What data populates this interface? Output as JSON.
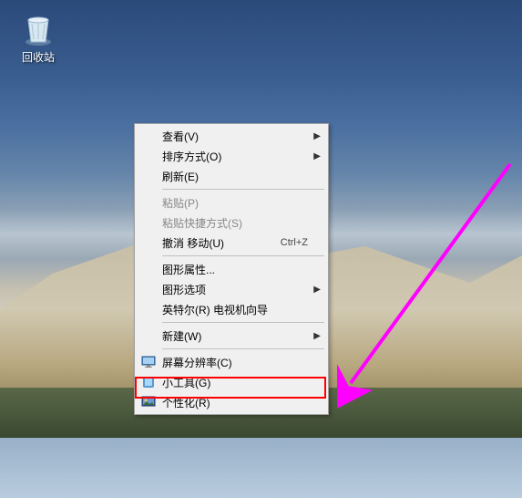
{
  "desktop": {
    "recycle_bin_label": "回收站"
  },
  "context_menu": {
    "items": [
      {
        "label": "查看(V)",
        "submenu": true
      },
      {
        "label": "排序方式(O)",
        "submenu": true
      },
      {
        "label": "刷新(E)"
      },
      null,
      {
        "label": "粘贴(P)",
        "disabled": true
      },
      {
        "label": "粘贴快捷方式(S)",
        "disabled": true
      },
      {
        "label": "撤消 移动(U)",
        "shortcut": "Ctrl+Z"
      },
      null,
      {
        "label": "图形属性..."
      },
      {
        "label": "图形选项",
        "submenu": true
      },
      {
        "label": "英特尔(R) 电视机向导"
      },
      null,
      {
        "label": "新建(W)",
        "submenu": true
      },
      null,
      {
        "label": "屏幕分辨率(C)",
        "icon": "monitor"
      },
      {
        "label": "小工具(G)",
        "icon": "gadget"
      },
      {
        "label": "个性化(R)",
        "icon": "personalize",
        "highlighted": true
      }
    ]
  },
  "annotation": {
    "highlight_color": "#ff0000",
    "arrow_color": "#ff00ff"
  }
}
